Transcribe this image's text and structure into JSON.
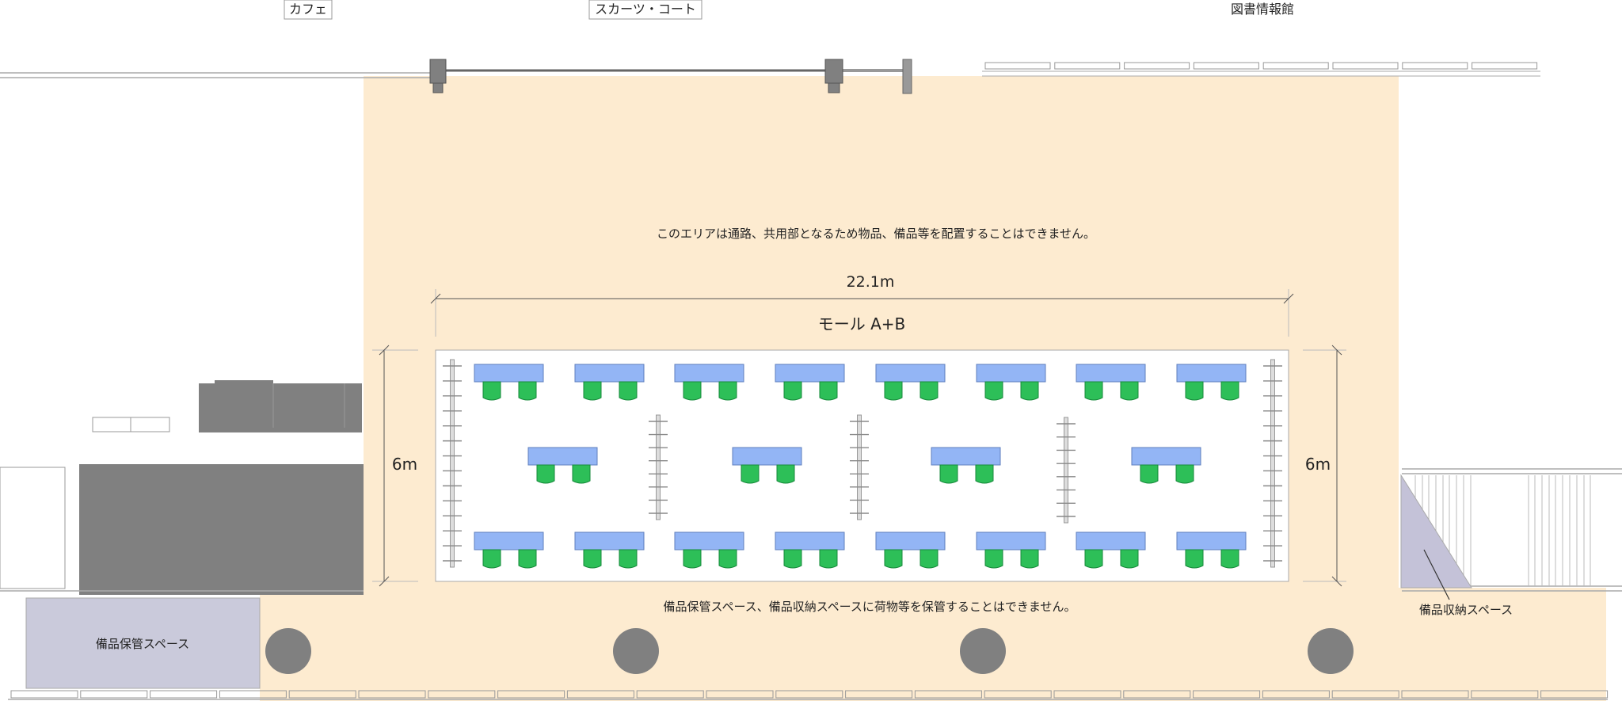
{
  "top_labels": {
    "cafe": "カフェ",
    "scarts_court": "スカーツ・コート",
    "library": "図書情報館"
  },
  "notes": {
    "no_placement": "このエリアは通路、共用部となるため物品、備品等を配置することはできません。",
    "no_storage": "備品保管スペース、備品収納スペースに荷物等を保管することはできません。"
  },
  "dimensions": {
    "width": "22.1m",
    "depth_left": "6m",
    "depth_right": "6m"
  },
  "venue": {
    "name": "モール A+B"
  },
  "spaces": {
    "equipment_keeping": "備品保管スペース",
    "equipment_storage": "備品収納スペース"
  },
  "colors": {
    "common_area": "#fdebd0",
    "table": "#93b5f5",
    "chair": "#2dbf58",
    "storage_area": "#cacadb",
    "building_gray": "#808080"
  },
  "layout_counts": {
    "top_row_tables": 8,
    "middle_row_tables": 4,
    "bottom_row_tables": 8,
    "chairs_per_table": 2
  }
}
